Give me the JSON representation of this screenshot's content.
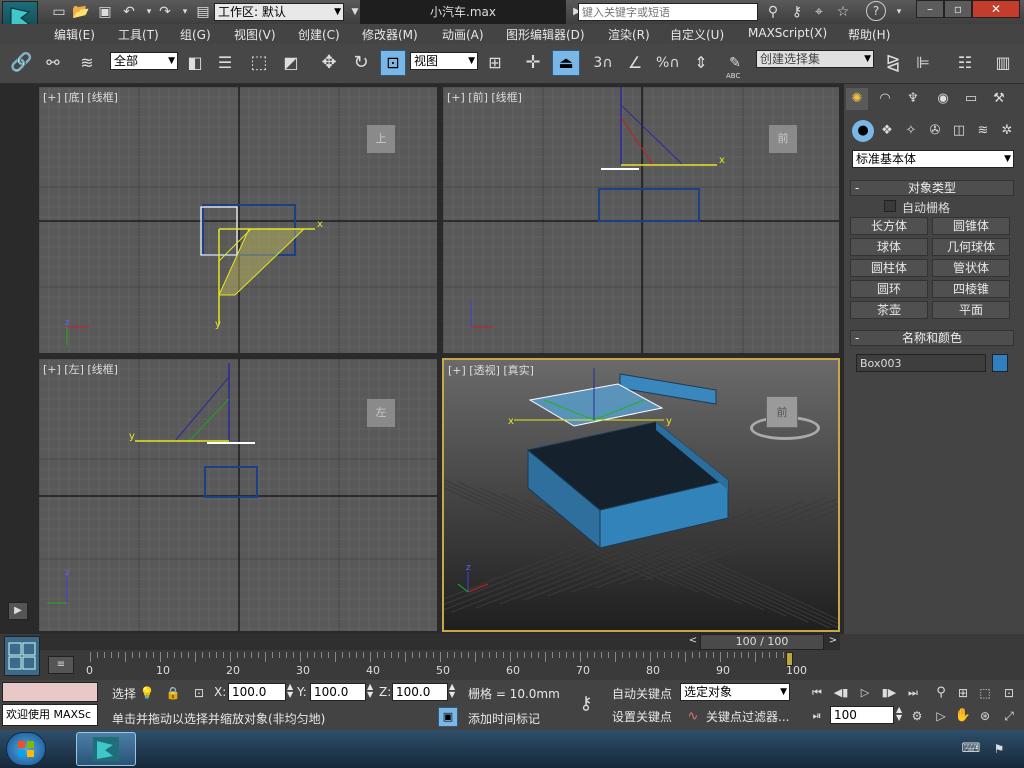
{
  "titlebar": {
    "workspace_label": "工作区: 默认",
    "file_title": "小汽车.max",
    "search_placeholder": "键入关键字或短语"
  },
  "menu": [
    "编辑(E)",
    "工具(T)",
    "组(G)",
    "视图(V)",
    "创建(C)",
    "修改器(M)",
    "动画(A)",
    "图形编辑器(D)",
    "渲染(R)",
    "自定义(U)",
    "MAXScript(X)",
    "帮助(H)"
  ],
  "toolbar": {
    "selection_filter": "全部",
    "ref_coord": "视图",
    "named_selection_placeholder": "创建选择集",
    "snap_3": "3",
    "snap_percent": "%",
    "abc_label": "ABC"
  },
  "viewports": {
    "top": {
      "label": "[+] [底] [线框]",
      "cube_text": "上"
    },
    "front": {
      "label": "[+] [前] [线框]",
      "cube_text": "前"
    },
    "left": {
      "label": "[+] [左] [线框]",
      "cube_text": "左"
    },
    "persp": {
      "label": "[+] [透视] [真实]",
      "cube_text": "前"
    }
  },
  "axes": {
    "x": "x",
    "y": "y",
    "z": "z"
  },
  "command_panel": {
    "category": "标准基本体",
    "object_type_title": "对象类型",
    "auto_grid": "自动栅格",
    "buttons": [
      "长方体",
      "圆锥体",
      "球体",
      "几何球体",
      "圆柱体",
      "管状体",
      "圆环",
      "四棱锥",
      "茶壶",
      "平面"
    ],
    "name_color_title": "名称和颜色",
    "object_name": "Box003",
    "object_color": "#2f7fc1"
  },
  "timeline": {
    "frame_display": "100 / 100",
    "ticks": [
      "0",
      "10",
      "20",
      "30",
      "40",
      "50",
      "60",
      "70",
      "80",
      "90",
      "100"
    ],
    "current_fraction": 1.0
  },
  "statusbar": {
    "maxscript_text": "欢迎使用 MAXSc",
    "selected_label": "选择",
    "x_label": "X:",
    "x_value": "100.0",
    "y_label": "Y:",
    "y_value": "100.0",
    "z_label": "Z:",
    "z_value": "100.0",
    "grid_label": "栅格 = 10.0mm",
    "prompt": "单击并拖动以选择并缩放对象(非均匀地)",
    "add_time_tag": "添加时间标记",
    "auto_key": "自动关键点",
    "set_key": "设置关键点",
    "key_mode_value": "选定对象",
    "key_filters": "关键点过滤器...",
    "frame_value": "100"
  }
}
